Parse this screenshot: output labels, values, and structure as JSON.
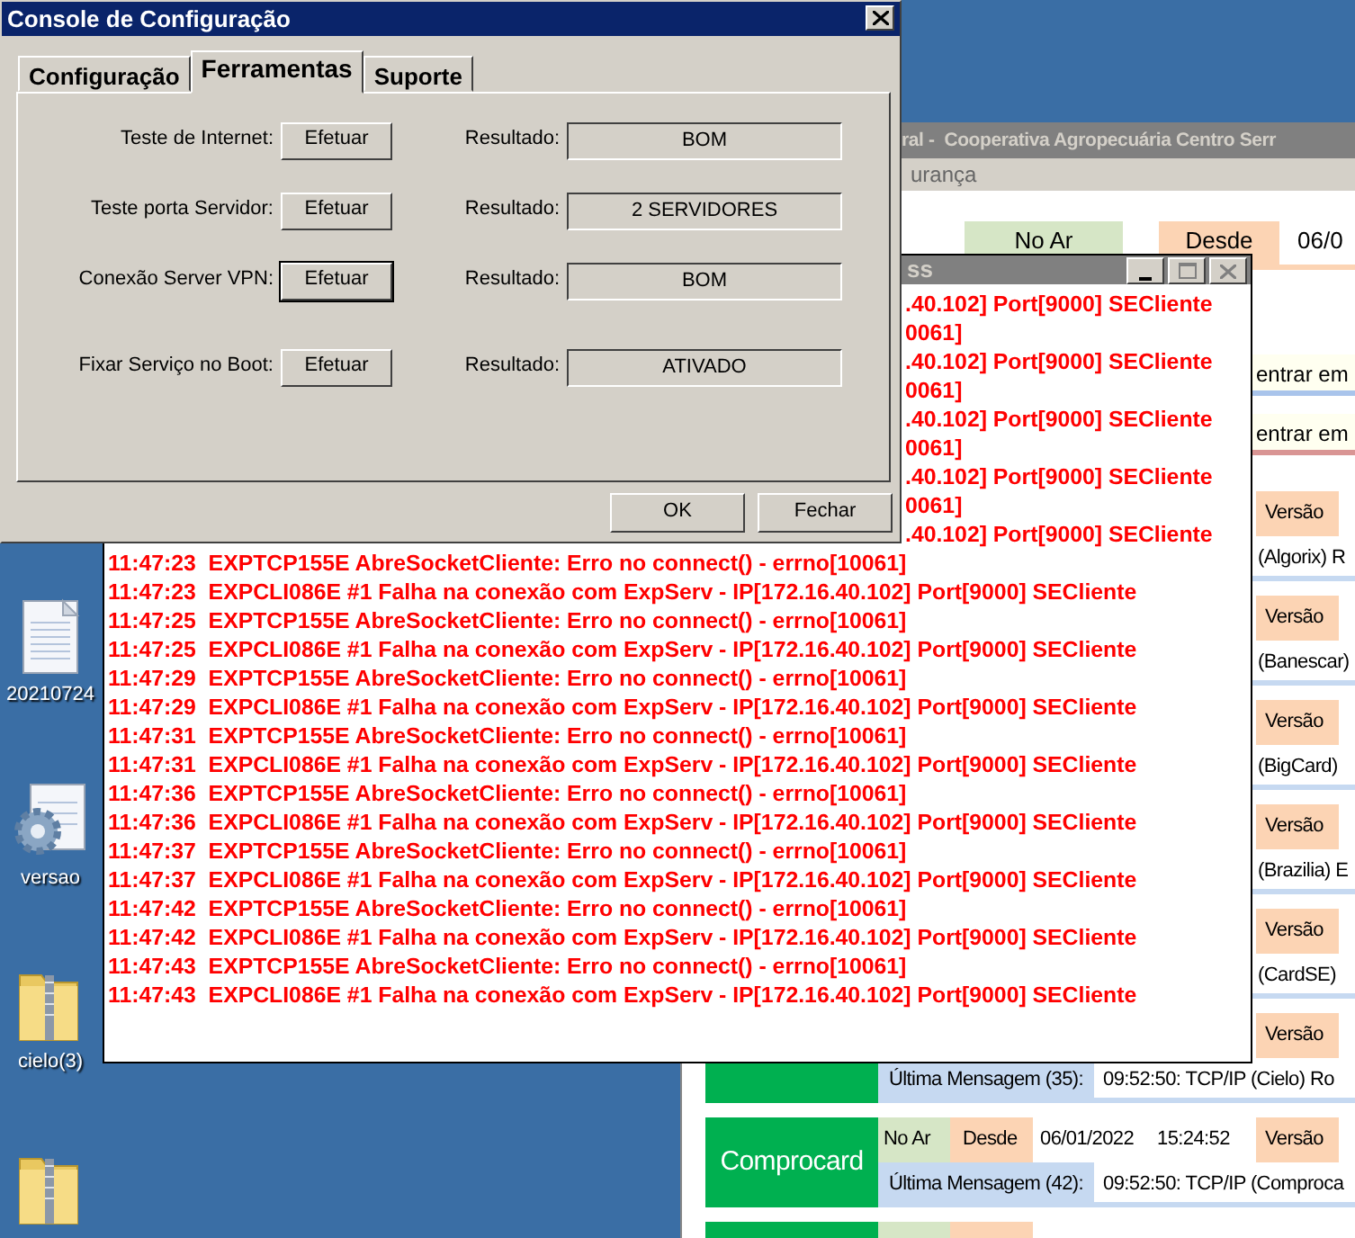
{
  "desktop_icons": [
    {
      "kind": "document",
      "label": "20210724"
    },
    {
      "kind": "settings-document",
      "label": "versao"
    },
    {
      "kind": "zip-folder",
      "label": "cielo(3)"
    },
    {
      "kind": "zip-folder"
    }
  ],
  "app_window": {
    "title": "ral -  Cooperativa Agropecuária Centro Serr",
    "menu": [
      "urança"
    ],
    "header": {
      "status": "No Ar",
      "since_label": "Desde",
      "date": "06/0"
    },
    "notices": [
      {
        "text": "entrar em",
        "color": "#a9c4eb"
      },
      {
        "text": "entrar em",
        "color": "#d99594"
      }
    ],
    "merchants": [
      {
        "kind": "covered",
        "version_label": "Versão",
        "message": "(Algorix) R"
      },
      {
        "kind": "covered",
        "version_label": "Versão",
        "message": "(Banescar)"
      },
      {
        "kind": "covered",
        "version_label": "Versão",
        "message": "(BigCard)"
      },
      {
        "kind": "covered",
        "version_label": "Versão",
        "message": "(Brazilia) E"
      },
      {
        "kind": "covered",
        "version_label": "Versão",
        "message": "(CardSE)"
      },
      {
        "kind": "partial",
        "version_label": "Versão",
        "message_label": "Última Mensagem (35):",
        "message": "09:52:50: TCP/IP (Cielo) Ro"
      },
      {
        "kind": "full",
        "name": "Comprocard",
        "status": "No Ar",
        "since_label": "Desde",
        "date": "06/01/2022",
        "time": "15:24:52",
        "version_label": "Versão",
        "message_label": "Última Mensagem (42):",
        "message": "09:52:50: TCP/IP (Comproca"
      },
      {
        "kind": "cut"
      }
    ]
  },
  "log_window": {
    "title": "ss",
    "lines": [
      {
        "kind": "partial",
        "text": ".40.102] Port[9000] SECliente"
      },
      {
        "kind": "partial",
        "text": "0061]"
      },
      {
        "kind": "partial",
        "text": ".40.102] Port[9000] SECliente"
      },
      {
        "kind": "partial",
        "text": "0061]"
      },
      {
        "kind": "partial",
        "text": ".40.102] Port[9000] SECliente"
      },
      {
        "kind": "partial",
        "text": "0061]"
      },
      {
        "kind": "partial",
        "text": ".40.102] Port[9000] SECliente"
      },
      {
        "kind": "partial",
        "text": "0061]"
      },
      {
        "kind": "partial",
        "text": ".40.102] Port[9000] SECliente"
      },
      {
        "kind": "full",
        "text": "11:47:23  EXPTCP155E AbreSocketCliente: Erro no connect() - errno[10061]"
      },
      {
        "kind": "full",
        "text": "11:47:23  EXPCLI086E #1 Falha na conexão com ExpServ - IP[172.16.40.102] Port[9000] SECliente"
      },
      {
        "kind": "full",
        "text": "11:47:25  EXPTCP155E AbreSocketCliente: Erro no connect() - errno[10061]"
      },
      {
        "kind": "full",
        "text": "11:47:25  EXPCLI086E #1 Falha na conexão com ExpServ - IP[172.16.40.102] Port[9000] SECliente"
      },
      {
        "kind": "full",
        "text": "11:47:29  EXPTCP155E AbreSocketCliente: Erro no connect() - errno[10061]"
      },
      {
        "kind": "full",
        "text": "11:47:29  EXPCLI086E #1 Falha na conexão com ExpServ - IP[172.16.40.102] Port[9000] SECliente"
      },
      {
        "kind": "full",
        "text": "11:47:31  EXPTCP155E AbreSocketCliente: Erro no connect() - errno[10061]"
      },
      {
        "kind": "full",
        "text": "11:47:31  EXPCLI086E #1 Falha na conexão com ExpServ - IP[172.16.40.102] Port[9000] SECliente"
      },
      {
        "kind": "full",
        "text": "11:47:36  EXPTCP155E AbreSocketCliente: Erro no connect() - errno[10061]"
      },
      {
        "kind": "full",
        "text": "11:47:36  EXPCLI086E #1 Falha na conexão com ExpServ - IP[172.16.40.102] Port[9000] SECliente"
      },
      {
        "kind": "full",
        "text": "11:47:37  EXPTCP155E AbreSocketCliente: Erro no connect() - errno[10061]"
      },
      {
        "kind": "full",
        "text": "11:47:37  EXPCLI086E #1 Falha na conexão com ExpServ - IP[172.16.40.102] Port[9000] SECliente"
      },
      {
        "kind": "full",
        "text": "11:47:42  EXPTCP155E AbreSocketCliente: Erro no connect() - errno[10061]"
      },
      {
        "kind": "full",
        "text": "11:47:42  EXPCLI086E #1 Falha na conexão com ExpServ - IP[172.16.40.102] Port[9000] SECliente"
      },
      {
        "kind": "full",
        "text": "11:47:43  EXPTCP155E AbreSocketCliente: Erro no connect() - errno[10061]"
      },
      {
        "kind": "full",
        "text": "11:47:43  EXPCLI086E #1 Falha na conexão com ExpServ - IP[172.16.40.102] Port[9000] SECliente"
      }
    ]
  },
  "dialog": {
    "title": "Console de Configuração",
    "tabs": [
      {
        "label": "Configuração",
        "selected": false
      },
      {
        "label": "Ferramentas",
        "selected": true
      },
      {
        "label": "Suporte",
        "selected": false
      }
    ],
    "tools": [
      {
        "label": "Teste de Internet:",
        "button": "Efetuar",
        "default": false,
        "result_label": "Resultado:",
        "result": "BOM"
      },
      {
        "label": "Teste porta Servidor:",
        "button": "Efetuar",
        "default": false,
        "result_label": "Resultado:",
        "result": "2 SERVIDORES"
      },
      {
        "label": "Conexão Server VPN:",
        "button": "Efetuar",
        "default": true,
        "result_label": "Resultado:",
        "result": "BOM"
      },
      {
        "label": "Fixar Serviço no Boot:",
        "button": "Efetuar",
        "default": false,
        "result_label": "Resultado:",
        "result": "ATIVADO"
      }
    ],
    "buttons": [
      "OK",
      "Fechar"
    ]
  }
}
